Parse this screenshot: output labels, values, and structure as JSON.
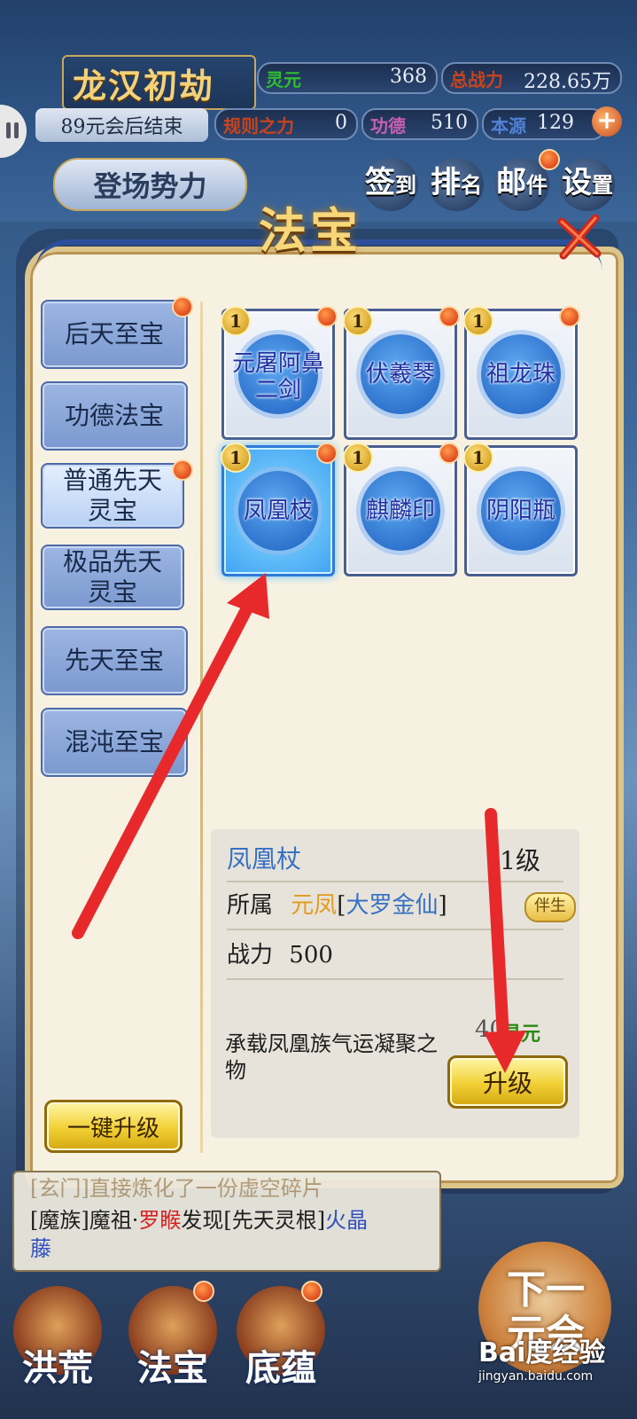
{
  "header": {
    "game_title": "龙汉初劫",
    "session_text": "89元会后结束",
    "resources": [
      {
        "label": "灵元",
        "value": "368",
        "color": "#2fbf2f"
      },
      {
        "label": "总战力",
        "value": "228.65万",
        "color": "#c8441c"
      },
      {
        "label": "规则之力",
        "value": "0",
        "color": "#c8441c"
      },
      {
        "label": "功德",
        "value": "510",
        "color": "#c75fb0"
      },
      {
        "label": "本源",
        "value": "129",
        "color": "#4f83d6"
      }
    ],
    "faction_button": "登场势力",
    "nav": [
      {
        "a": "签",
        "b": "到"
      },
      {
        "a": "排",
        "b": "名"
      },
      {
        "a": "邮",
        "b": "件"
      },
      {
        "a": "设",
        "b": "置"
      }
    ]
  },
  "modal": {
    "title": "法宝",
    "categories": [
      {
        "label": "后天至宝",
        "badge": true
      },
      {
        "label": "功德法宝",
        "badge": false
      },
      {
        "label": "普通先天灵宝",
        "badge": true
      },
      {
        "label": "极品先天灵宝",
        "badge": false
      },
      {
        "label": "先天至宝",
        "badge": false
      },
      {
        "label": "混沌至宝",
        "badge": false
      }
    ],
    "items": [
      {
        "name": "元屠阿鼻二剑",
        "level": "1"
      },
      {
        "name": "伏羲琴",
        "level": "1"
      },
      {
        "name": "祖龙珠",
        "level": "1"
      },
      {
        "name": "凤凰枝",
        "level": "1"
      },
      {
        "name": "麒麟印",
        "level": "1"
      },
      {
        "name": "阴阳瓶",
        "level": "1"
      }
    ],
    "detail": {
      "name": "凤凰杖",
      "level": "1级",
      "owner_label": "所属",
      "owner_name": "元凤",
      "owner_realm": "大罗金仙",
      "companion_badge": "伴生",
      "power_label": "战力",
      "power_value": "500",
      "description": "承载凤凰族气运凝聚之物",
      "cost_number": "40",
      "cost_unit": "灵元",
      "upgrade_label": "升级"
    },
    "one_click_upgrade_label": "一键升级"
  },
  "log": {
    "line1": "[玄门]直接炼化了一份虚空碎片",
    "line2_a": "[魔族]魔祖·",
    "line2_b": "罗睺",
    "line2_c": "发现[先天灵根]",
    "line2_d": "火晶",
    "line3": "藤"
  },
  "bottom_nav": [
    {
      "label": "洪荒"
    },
    {
      "label": "法宝"
    },
    {
      "label": "底蕴"
    }
  ],
  "next_button": "下一元会",
  "watermark": {
    "brand": "Bai度经验",
    "url": "jingyan.baidu.com"
  },
  "colors": {
    "accent_gold": "#f3d27a",
    "arrow_red": "#e8292b",
    "panel_bg": "#f7f1e2"
  }
}
